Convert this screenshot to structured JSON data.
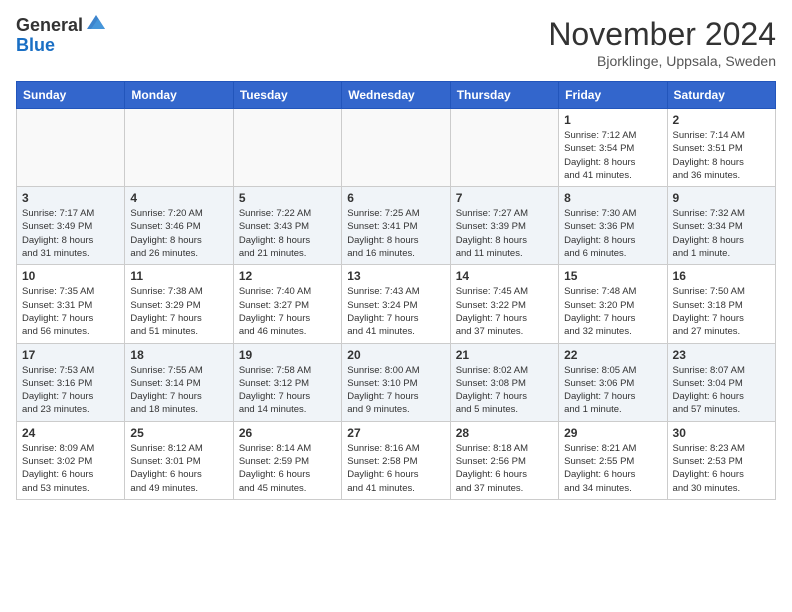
{
  "header": {
    "logo_general": "General",
    "logo_blue": "Blue",
    "month_year": "November 2024",
    "location": "Bjorklinge, Uppsala, Sweden"
  },
  "weekdays": [
    "Sunday",
    "Monday",
    "Tuesday",
    "Wednesday",
    "Thursday",
    "Friday",
    "Saturday"
  ],
  "weeks": [
    [
      {
        "day": "",
        "info": ""
      },
      {
        "day": "",
        "info": ""
      },
      {
        "day": "",
        "info": ""
      },
      {
        "day": "",
        "info": ""
      },
      {
        "day": "",
        "info": ""
      },
      {
        "day": "1",
        "info": "Sunrise: 7:12 AM\nSunset: 3:54 PM\nDaylight: 8 hours\nand 41 minutes."
      },
      {
        "day": "2",
        "info": "Sunrise: 7:14 AM\nSunset: 3:51 PM\nDaylight: 8 hours\nand 36 minutes."
      }
    ],
    [
      {
        "day": "3",
        "info": "Sunrise: 7:17 AM\nSunset: 3:49 PM\nDaylight: 8 hours\nand 31 minutes."
      },
      {
        "day": "4",
        "info": "Sunrise: 7:20 AM\nSunset: 3:46 PM\nDaylight: 8 hours\nand 26 minutes."
      },
      {
        "day": "5",
        "info": "Sunrise: 7:22 AM\nSunset: 3:43 PM\nDaylight: 8 hours\nand 21 minutes."
      },
      {
        "day": "6",
        "info": "Sunrise: 7:25 AM\nSunset: 3:41 PM\nDaylight: 8 hours\nand 16 minutes."
      },
      {
        "day": "7",
        "info": "Sunrise: 7:27 AM\nSunset: 3:39 PM\nDaylight: 8 hours\nand 11 minutes."
      },
      {
        "day": "8",
        "info": "Sunrise: 7:30 AM\nSunset: 3:36 PM\nDaylight: 8 hours\nand 6 minutes."
      },
      {
        "day": "9",
        "info": "Sunrise: 7:32 AM\nSunset: 3:34 PM\nDaylight: 8 hours\nand 1 minute."
      }
    ],
    [
      {
        "day": "10",
        "info": "Sunrise: 7:35 AM\nSunset: 3:31 PM\nDaylight: 7 hours\nand 56 minutes."
      },
      {
        "day": "11",
        "info": "Sunrise: 7:38 AM\nSunset: 3:29 PM\nDaylight: 7 hours\nand 51 minutes."
      },
      {
        "day": "12",
        "info": "Sunrise: 7:40 AM\nSunset: 3:27 PM\nDaylight: 7 hours\nand 46 minutes."
      },
      {
        "day": "13",
        "info": "Sunrise: 7:43 AM\nSunset: 3:24 PM\nDaylight: 7 hours\nand 41 minutes."
      },
      {
        "day": "14",
        "info": "Sunrise: 7:45 AM\nSunset: 3:22 PM\nDaylight: 7 hours\nand 37 minutes."
      },
      {
        "day": "15",
        "info": "Sunrise: 7:48 AM\nSunset: 3:20 PM\nDaylight: 7 hours\nand 32 minutes."
      },
      {
        "day": "16",
        "info": "Sunrise: 7:50 AM\nSunset: 3:18 PM\nDaylight: 7 hours\nand 27 minutes."
      }
    ],
    [
      {
        "day": "17",
        "info": "Sunrise: 7:53 AM\nSunset: 3:16 PM\nDaylight: 7 hours\nand 23 minutes."
      },
      {
        "day": "18",
        "info": "Sunrise: 7:55 AM\nSunset: 3:14 PM\nDaylight: 7 hours\nand 18 minutes."
      },
      {
        "day": "19",
        "info": "Sunrise: 7:58 AM\nSunset: 3:12 PM\nDaylight: 7 hours\nand 14 minutes."
      },
      {
        "day": "20",
        "info": "Sunrise: 8:00 AM\nSunset: 3:10 PM\nDaylight: 7 hours\nand 9 minutes."
      },
      {
        "day": "21",
        "info": "Sunrise: 8:02 AM\nSunset: 3:08 PM\nDaylight: 7 hours\nand 5 minutes."
      },
      {
        "day": "22",
        "info": "Sunrise: 8:05 AM\nSunset: 3:06 PM\nDaylight: 7 hours\nand 1 minute."
      },
      {
        "day": "23",
        "info": "Sunrise: 8:07 AM\nSunset: 3:04 PM\nDaylight: 6 hours\nand 57 minutes."
      }
    ],
    [
      {
        "day": "24",
        "info": "Sunrise: 8:09 AM\nSunset: 3:02 PM\nDaylight: 6 hours\nand 53 minutes."
      },
      {
        "day": "25",
        "info": "Sunrise: 8:12 AM\nSunset: 3:01 PM\nDaylight: 6 hours\nand 49 minutes."
      },
      {
        "day": "26",
        "info": "Sunrise: 8:14 AM\nSunset: 2:59 PM\nDaylight: 6 hours\nand 45 minutes."
      },
      {
        "day": "27",
        "info": "Sunrise: 8:16 AM\nSunset: 2:58 PM\nDaylight: 6 hours\nand 41 minutes."
      },
      {
        "day": "28",
        "info": "Sunrise: 8:18 AM\nSunset: 2:56 PM\nDaylight: 6 hours\nand 37 minutes."
      },
      {
        "day": "29",
        "info": "Sunrise: 8:21 AM\nSunset: 2:55 PM\nDaylight: 6 hours\nand 34 minutes."
      },
      {
        "day": "30",
        "info": "Sunrise: 8:23 AM\nSunset: 2:53 PM\nDaylight: 6 hours\nand 30 minutes."
      }
    ]
  ]
}
